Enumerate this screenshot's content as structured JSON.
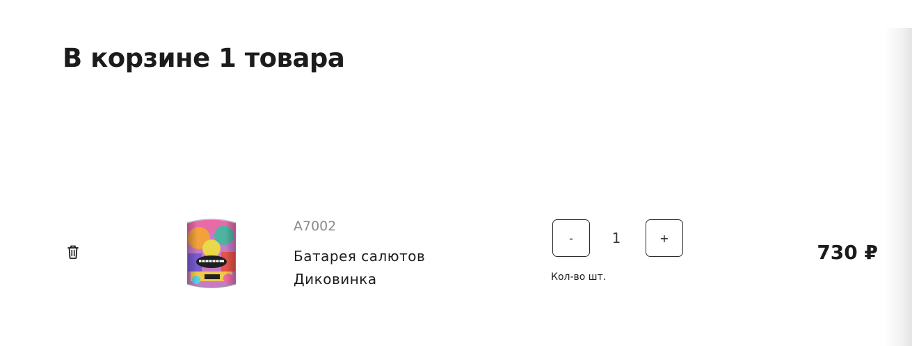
{
  "cart": {
    "title": "В корзине 1 товара",
    "items": [
      {
        "sku": "A7002",
        "name": "Батарея салютов Диковинка",
        "quantity": "1",
        "minus_label": "-",
        "plus_label": "+",
        "quantity_caption": "Кол-во шт.",
        "price": "730 ₽",
        "delete_icon": "trash-icon"
      }
    ]
  }
}
